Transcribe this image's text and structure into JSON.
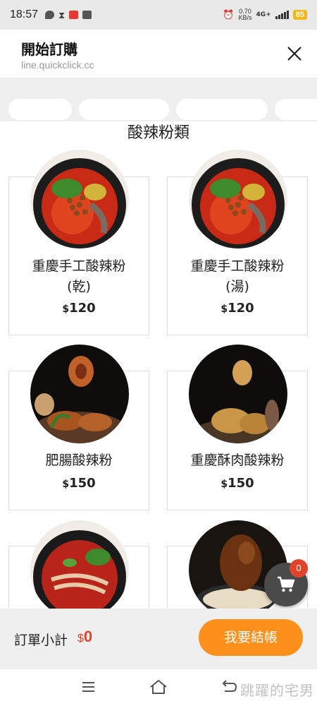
{
  "status_bar": {
    "time": "18:57",
    "speed_value": "0.70",
    "speed_unit": "KB/s",
    "network": "4G+",
    "battery": "85"
  },
  "header": {
    "title": "開始訂購",
    "url": "line.quickclick.cc"
  },
  "section": {
    "title": "酸辣粉類"
  },
  "products": [
    {
      "name": "重慶手工酸辣粉\n(乾)",
      "currency": "$",
      "price": "120",
      "photo": "dry-noodle-bowl"
    },
    {
      "name": "重慶手工酸辣粉\n(湯)",
      "currency": "$",
      "price": "120",
      "photo": "soup-noodle-bowl"
    },
    {
      "name": "肥腸酸辣粉",
      "currency": "$",
      "price": "150",
      "photo": "pork-intestine"
    },
    {
      "name": "重慶酥肉酸辣粉",
      "currency": "$",
      "price": "150",
      "photo": "fried-pork"
    }
  ],
  "cart": {
    "count": "0"
  },
  "order_bar": {
    "label": "訂單小計",
    "currency": "$",
    "total": "0",
    "checkout_label": "我要結帳"
  },
  "watermark": "跳躍的宅男",
  "colors": {
    "accent_orange": "#fd8f1b",
    "price_red": "#e0452c",
    "cart_dark": "#4a4a4a"
  }
}
